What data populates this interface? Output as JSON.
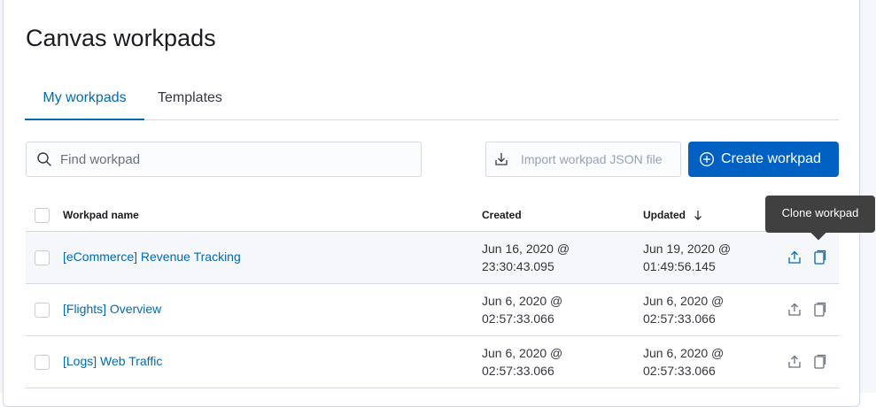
{
  "page": {
    "title": "Canvas workpads"
  },
  "tabs": [
    {
      "label": "My workpads",
      "active": true
    },
    {
      "label": "Templates",
      "active": false
    }
  ],
  "search": {
    "placeholder": "Find workpad",
    "value": ""
  },
  "toolbar": {
    "import_label": "Import workpad JSON file",
    "create_label": "Create workpad"
  },
  "table": {
    "columns": {
      "name": "Workpad name",
      "created": "Created",
      "updated": "Updated"
    },
    "sort": {
      "column": "Updated",
      "direction": "descending"
    },
    "rows": [
      {
        "name": "[eCommerce] Revenue Tracking",
        "created_date": "Jun 16, 2020 @",
        "created_time": "23:30:43.095",
        "updated_date": "Jun 19, 2020 @",
        "updated_time": "01:49:56.145"
      },
      {
        "name": "[Flights] Overview",
        "created_date": "Jun 6, 2020 @",
        "created_time": "02:57:33.066",
        "updated_date": "Jun 6, 2020 @",
        "updated_time": "02:57:33.066"
      },
      {
        "name": "[Logs] Web Traffic",
        "created_date": "Jun 6, 2020 @",
        "created_time": "02:57:33.066",
        "updated_date": "Jun 6, 2020 @",
        "updated_time": "02:57:33.066"
      }
    ]
  },
  "tooltip": {
    "text": "Clone workpad"
  },
  "colors": {
    "accent": "#006bb4",
    "primary_button": "#0061c2",
    "tooltip_bg": "#404040"
  },
  "icons": [
    "search-icon",
    "import-icon",
    "plus-circle-icon",
    "sort-down-icon",
    "export-icon",
    "copy-icon"
  ]
}
